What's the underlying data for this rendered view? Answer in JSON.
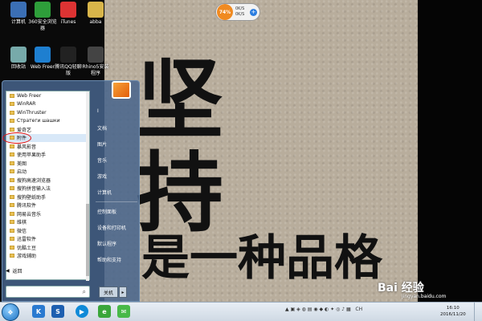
{
  "desktop_icons": [
    {
      "label": "计算机",
      "icon": "computer-icon",
      "color": "#3b6fb5"
    },
    {
      "label": "360安全浏览器",
      "icon": "browser-icon",
      "color": "#2e9e3a"
    },
    {
      "label": "iTunes",
      "icon": "itunes-icon",
      "color": "#d33"
    },
    {
      "label": "abba",
      "icon": "folder-icon",
      "color": "#d8b54a"
    },
    {
      "label": "回收站",
      "icon": "recycle-bin-icon",
      "color": "#7aa"
    },
    {
      "label": "Web Freer",
      "icon": "web-freer-icon",
      "color": "#1e7fd0"
    },
    {
      "label": "腾讯QQ轻聊版",
      "icon": "qq-icon",
      "color": "#222"
    },
    {
      "label": "Rhino5安装程序",
      "icon": "installer-icon",
      "color": "#444"
    }
  ],
  "widget": {
    "percent": "74%",
    "up": "0K/S",
    "down": "0K/S"
  },
  "wallpaper": {
    "line1": "坚",
    "line2": "持",
    "line3": "是一种品格"
  },
  "start_menu": {
    "programs": [
      "Web Freer",
      "WinRAR",
      "WinThruster",
      "Стратеги шашки",
      "爱奇艺",
      "附件",
      "暴风影音",
      "使用苹果助手",
      "美图",
      "启动",
      "搜狗高速浏览器",
      "搜狗拼音输入法",
      "搜狗壁纸助手",
      "腾讯软件",
      "网易云音乐",
      "维棋",
      "微信",
      "迅雷软件",
      "优酷土豆",
      "游戏辅助"
    ],
    "selected_index": 5,
    "back_label": "返回",
    "search_placeholder": "",
    "right_items": [
      "I",
      "文档",
      "图片",
      "音乐",
      "游戏",
      "计算机",
      "控制面板",
      "设备和打印机",
      "默认程序",
      "帮助和支持"
    ],
    "shutdown_label": "关机"
  },
  "taskbar": {
    "start_label": "",
    "tray_text": "CH",
    "clock_time": "16:10",
    "clock_date": "2016/11/20"
  },
  "watermark": {
    "brand": "Bai 经验",
    "url": "jingyan.baidu.com"
  }
}
